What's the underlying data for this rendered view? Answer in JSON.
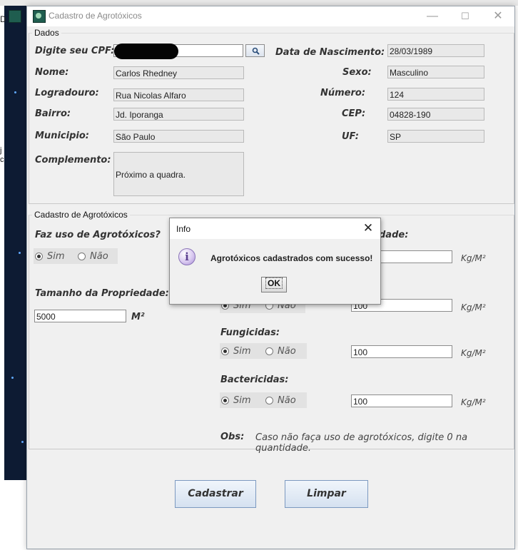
{
  "window": {
    "title": "Cadastro de Agrotóxicos",
    "controls": {
      "minimize": "—",
      "maximize": "☐",
      "close": "✕"
    }
  },
  "dados": {
    "legend": "Dados",
    "cpf_label": "Digite seu CPF:",
    "nascimento_label": "Data de Nascimento:",
    "nascimento_value": "28/03/1989",
    "nome_label": "Nome:",
    "nome_value": "Carlos Rhedney",
    "sexo_label": "Sexo:",
    "sexo_value": "Masculino",
    "logradouro_label": "Logradouro:",
    "logradouro_value": "Rua Nicolas Alfaro",
    "numero_label": "Número:",
    "numero_value": "124",
    "bairro_label": "Bairro:",
    "bairro_value": "Jd. Iporanga",
    "cep_label": "CEP:",
    "cep_value": "04828-190",
    "municipio_label": "Municipio:",
    "municipio_value": "São Paulo",
    "uf_label": "UF:",
    "uf_value": "SP",
    "complemento_label": "Complemento:",
    "complemento_value": "Próximo a quadra."
  },
  "agro": {
    "legend": "Cadastro de Agrotóxicos",
    "faz_uso_label": "Faz uso de Agrotóxicos?",
    "sim": "Sim",
    "nao": "Não",
    "quantidade_label": "Quantidade:",
    "unit": "Kg/M²",
    "tamanho_label": "Tamanho da Propriedade:",
    "tamanho_value": "5000",
    "tamanho_unit": "M²",
    "row2_value": "100",
    "fungicidas_label": "Fungicidas:",
    "fungicidas_value": "100",
    "bactericidas_label": "Bactericidas:",
    "bactericidas_value": "100",
    "obs_label": "Obs:",
    "obs_text": "Caso não faça uso de agrotóxicos, digite 0 na quantidade."
  },
  "buttons": {
    "cadastrar": "Cadastrar",
    "limpar": "Limpar"
  },
  "dialog": {
    "title": "Info",
    "close": "✕",
    "icon": "i",
    "message": "Agrotóxicos cadastrados com sucesso!",
    "ok": "OK"
  },
  "background": {
    "left_text_1": "j",
    "left_text_2": "c",
    "title_letter": "D"
  }
}
